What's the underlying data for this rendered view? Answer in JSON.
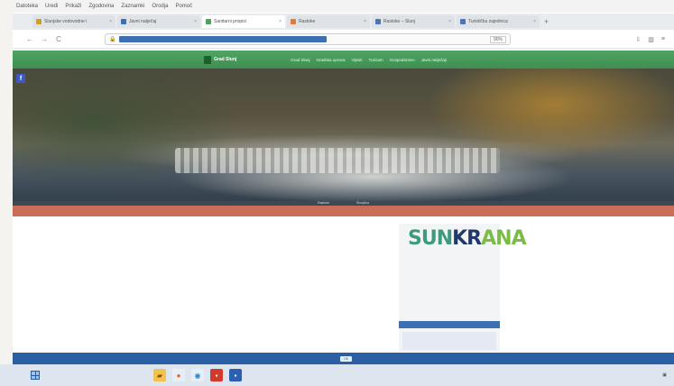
{
  "menubar": [
    "Datoteka",
    "Uredi",
    "Prikaži",
    "Zgodovina",
    "Zaznamki",
    "Orodja",
    "Pomoč"
  ],
  "tabs": [
    {
      "label": "Slunjske vodovodne i",
      "color": "#c9a227",
      "active": false
    },
    {
      "label": "Javni natječaj",
      "color": "#3b6fb0",
      "active": false
    },
    {
      "label": "Sanitarni propisi",
      "color": "#4aa55a",
      "active": true
    },
    {
      "label": "Rastoke",
      "color": "#e07b39",
      "active": false
    },
    {
      "label": "Rastoke – Slunj",
      "color": "#4a76b8",
      "active": false
    },
    {
      "label": "Turistička zajednica",
      "color": "#4a76b8",
      "active": false
    }
  ],
  "navbar": {
    "back": "←",
    "forward": "→",
    "reload": "C",
    "lock": "🔒",
    "url": "",
    "zoom": "90%"
  },
  "site": {
    "logo": "Grad Slunj",
    "nav": [
      "Grad Slunj",
      "Gradska uprava",
      "Vijesti",
      "Turizam",
      "Gospodarstvo",
      "Javni natječaji"
    ],
    "hero_captions": [
      "Rastoke",
      "Slunjčica"
    ],
    "facebook": "f"
  },
  "content": {
    "crumb": "",
    "title": "",
    "date": "",
    "text": "",
    "links": [],
    "foot_left": "",
    "foot_right": "",
    "thumb": {
      "t1": "",
      "t2": "",
      "t3": "",
      "t4": "",
      "t5": ""
    }
  },
  "sidebar": {
    "logo_a": "SUN",
    "logo_b": "KR",
    "logo_c": "ANA",
    "subtitle": "",
    "items": [],
    "mid": "",
    "head": "",
    "box": ""
  },
  "cookie": {
    "text": "",
    "button": "OK"
  },
  "taskbar": {
    "search": "",
    "apps": [
      {
        "icon": "folder-icon",
        "glyph": "▰",
        "bg": "#f2c14e",
        "fg": "#7a5a10"
      },
      {
        "icon": "browser-icon",
        "glyph": "●",
        "bg": "#e8eef5",
        "fg": "#e2622b"
      },
      {
        "icon": "edge-icon",
        "glyph": "◉",
        "bg": "#e8eef5",
        "fg": "#1e88c8"
      },
      {
        "icon": "pdf-icon",
        "glyph": "▪",
        "bg": "#d23a2b",
        "fg": "#fff"
      },
      {
        "icon": "word-icon",
        "glyph": "▪",
        "bg": "#2b5fb3",
        "fg": "#fff"
      }
    ],
    "tray": "",
    "time": "",
    "date": ""
  }
}
